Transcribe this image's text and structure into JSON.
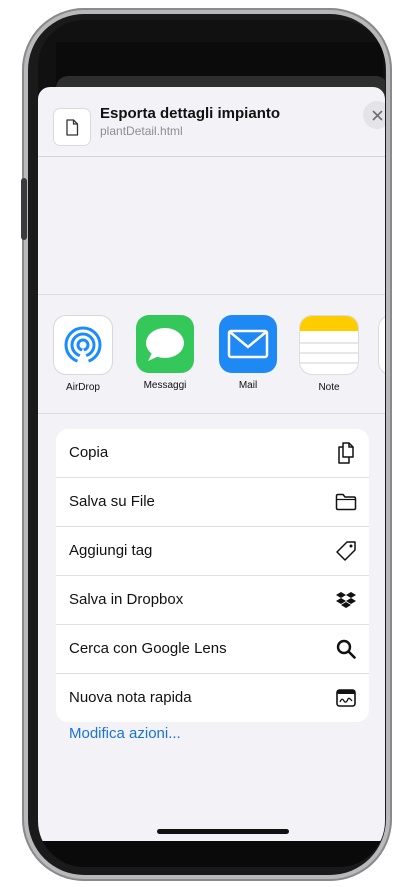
{
  "share_sheet": {
    "title": "Esporta dettagli impianto",
    "filename": "plantDetail.html",
    "close_icon": "close-icon"
  },
  "apps": [
    {
      "label": "AirDrop",
      "icon": "airdrop-icon",
      "color": "#1a8cff"
    },
    {
      "label": "Messaggi",
      "icon": "messages-icon",
      "color": "#34c759"
    },
    {
      "label": "Mail",
      "icon": "mail-icon",
      "color": "#1e88f5"
    },
    {
      "label": "Note",
      "icon": "notes-icon",
      "color": "#ffcc00"
    }
  ],
  "actions": [
    {
      "label": "Copia",
      "icon": "copy-icon"
    },
    {
      "label": "Salva su File",
      "icon": "folder-icon"
    },
    {
      "label": "Aggiungi tag",
      "icon": "tag-icon"
    },
    {
      "label": "Salva in Dropbox",
      "icon": "dropbox-icon"
    },
    {
      "label": "Cerca con Google Lens",
      "icon": "search-icon"
    },
    {
      "label": "Nuova nota rapida",
      "icon": "quick-note-icon"
    }
  ],
  "edit_actions_label": "Modifica azioni...",
  "colors": {
    "accent": "#1a73d8",
    "sheet_background": "#f2f2f7"
  }
}
